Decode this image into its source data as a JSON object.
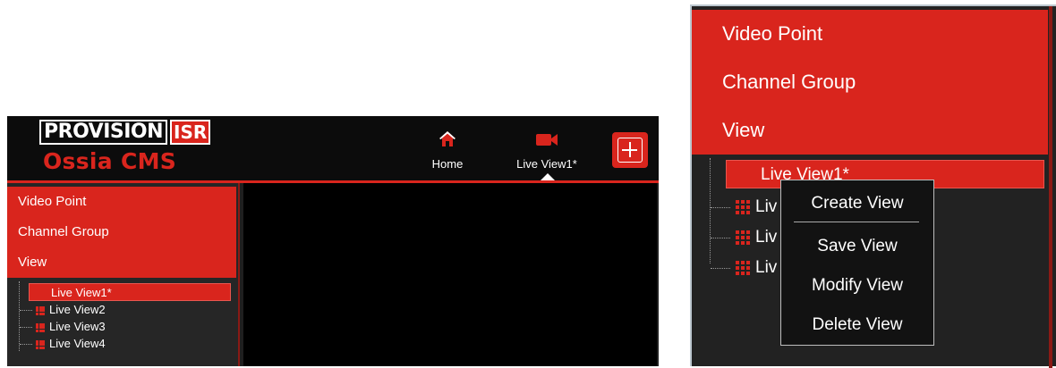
{
  "app": {
    "brand_main": "PROVISION",
    "brand_isr": "ISR",
    "product": "Ossia CMS",
    "nav": [
      {
        "label": "Home",
        "icon": "home-icon"
      },
      {
        "label": "Live View1*",
        "icon": "video-camera-icon"
      }
    ],
    "add_icon": "plus-icon"
  },
  "sidebar": {
    "menu": [
      "Video Point",
      "Channel Group",
      "View"
    ],
    "views": [
      "Live View1*",
      "Live View2",
      "Live View3",
      "Live View4"
    ],
    "selected_view": "Live View1*"
  },
  "zoom": {
    "menu": [
      "Video Point",
      "Channel Group",
      "View"
    ],
    "selected_view": "Live View1*",
    "partial_views": [
      "Liv",
      "Liv",
      "Liv"
    ],
    "context_menu": [
      "Create View",
      "Save View",
      "Modify View",
      "Delete View"
    ]
  },
  "colors": {
    "accent": "#d9251d",
    "topbar": "#0c0c0c",
    "panel": "#262626",
    "video_area": "#000000"
  }
}
